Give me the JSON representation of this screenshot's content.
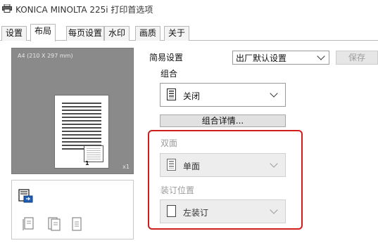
{
  "window": {
    "title": "KONICA MINOLTA 225i 打印首选项",
    "icon": "printer-icon"
  },
  "tabs": [
    {
      "label": "设置",
      "active": false
    },
    {
      "label": "布局",
      "active": true
    },
    {
      "label": "每页设置",
      "active": false
    },
    {
      "label": "水印",
      "active": false
    },
    {
      "label": "画质",
      "active": false
    },
    {
      "label": "关于",
      "active": false
    }
  ],
  "preview": {
    "paper_size": "A4 (210 X 297 mm)",
    "page_number": "1",
    "copies": "x1"
  },
  "quick_settings": {
    "label": "简易设置",
    "selected": "出厂默认设置",
    "save_label": "保存"
  },
  "combination": {
    "label": "组合",
    "selected": "关闭",
    "details_label": "组合详情..."
  },
  "duplex": {
    "label": "双面",
    "selected": "单面"
  },
  "binding_position": {
    "label": "装订位置",
    "selected": "左装订"
  },
  "colors": {
    "highlight": "#d11c1c",
    "preview_bg": "#8a8a8a"
  }
}
